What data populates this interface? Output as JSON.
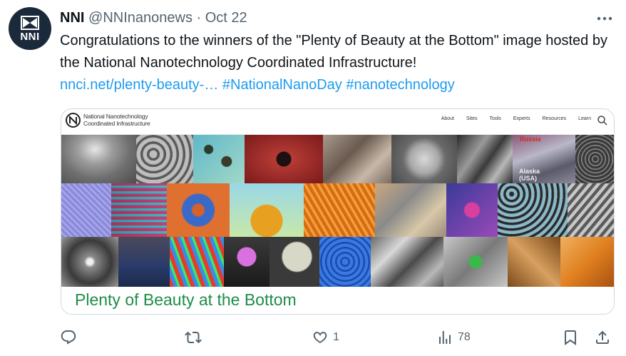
{
  "account": {
    "name": "NNI",
    "handle": "@NNInanonews",
    "separator": "·",
    "date": "Oct 22",
    "avatar_text": "NNI"
  },
  "tweet": {
    "text": "Congratulations to the winners of the \"Plenty of Beauty at the Bottom\" image hosted by the National Nanotechnology Coordinated Infrastructure!",
    "link": "nnci.net/plenty-beauty-…",
    "hashtag1": "#NationalNanoDay",
    "hashtag2": "#nanotechnology"
  },
  "card": {
    "site_name_line1": "National Nanotechnology",
    "site_name_line2": "Coordinated Infrastructure",
    "nav": [
      "About",
      "Sites",
      "Tools",
      "Experts",
      "Resources",
      "Learn"
    ],
    "title": "Plenty of Beauty at the Bottom",
    "mosaic_labels": [
      "Russia",
      "Alaska",
      "(USA)"
    ]
  },
  "actions": {
    "reply_count": "",
    "retweet_count": "",
    "like_count": "1",
    "views_count": "78"
  },
  "colors": {
    "link": "#1d9bf0",
    "card_title": "#1e8c49",
    "muted": "#536471"
  }
}
